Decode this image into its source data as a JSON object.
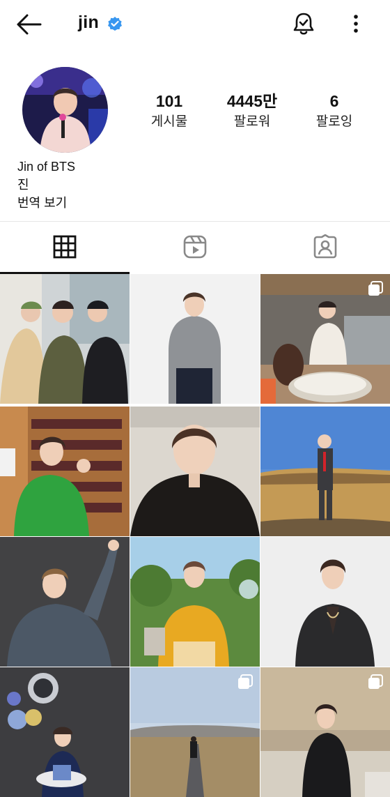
{
  "header": {
    "back_icon": "arrow-left-icon",
    "username": "jin",
    "verified_icon": "verified-badge-icon",
    "notification_icon": "bell-check-icon",
    "more_icon": "more-vertical-icon"
  },
  "profile": {
    "stats": {
      "posts": {
        "value": "101",
        "label": "게시물"
      },
      "followers": {
        "value": "4445만",
        "label": "팔로워"
      },
      "following": {
        "value": "6",
        "label": "팔로잉"
      }
    },
    "bio": {
      "name": "Jin of BTS",
      "text": "진",
      "translate": "번역 보기"
    }
  },
  "tabs": [
    {
      "icon": "grid-icon",
      "active": true
    },
    {
      "icon": "reels-icon",
      "active": false
    },
    {
      "icon": "tagged-person-icon",
      "active": false
    }
  ],
  "posts": [
    {
      "name": "post-1",
      "multi": false
    },
    {
      "name": "post-2",
      "multi": false
    },
    {
      "name": "post-3",
      "multi": true
    },
    {
      "name": "post-4",
      "multi": false
    },
    {
      "name": "post-5",
      "multi": false
    },
    {
      "name": "post-6",
      "multi": false
    },
    {
      "name": "post-7",
      "multi": false
    },
    {
      "name": "post-8",
      "multi": false
    },
    {
      "name": "post-9",
      "multi": false
    },
    {
      "name": "post-10",
      "multi": false
    },
    {
      "name": "post-11",
      "multi": true
    },
    {
      "name": "post-12",
      "multi": true
    }
  ],
  "colors": {
    "verified": "#3897f0",
    "text": "#111111",
    "divider": "#e6e6e6",
    "icon_inactive": "#888888"
  }
}
